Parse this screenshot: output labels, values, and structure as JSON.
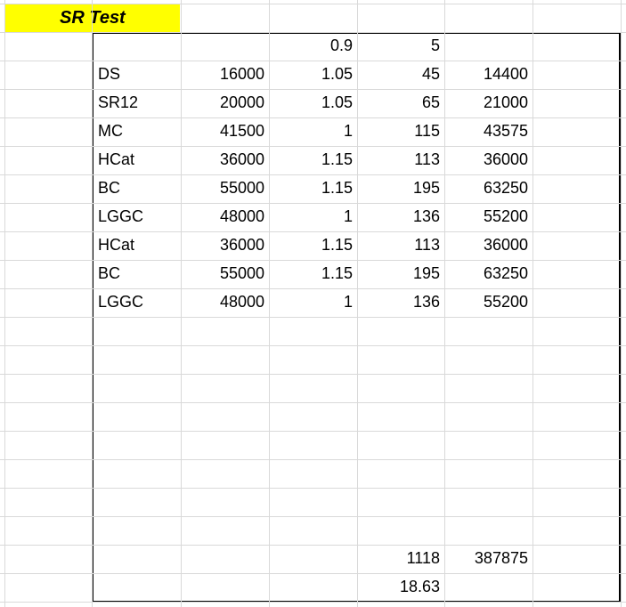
{
  "sheet": {
    "title": "SR Test",
    "header_row": [
      "",
      "",
      "0.9",
      "5",
      ""
    ],
    "rows": [
      [
        "DS",
        "16000",
        "1.05",
        "45",
        "14400"
      ],
      [
        "SR12",
        "20000",
        "1.05",
        "65",
        "21000"
      ],
      [
        "MC",
        "41500",
        "1",
        "115",
        "43575"
      ],
      [
        "HCat",
        "36000",
        "1.15",
        "113",
        "36000"
      ],
      [
        "BC",
        "55000",
        "1.15",
        "195",
        "63250"
      ],
      [
        "LGGC",
        "48000",
        "1",
        "136",
        "55200"
      ],
      [
        "HCat",
        "36000",
        "1.15",
        "113",
        "36000"
      ],
      [
        "BC",
        "55000",
        "1.15",
        "195",
        "63250"
      ],
      [
        "LGGC",
        "48000",
        "1",
        "136",
        "55200"
      ]
    ],
    "totals_row": [
      "",
      "",
      "",
      "1118",
      "387875"
    ],
    "ratio_row": [
      "",
      "",
      "",
      "18.63",
      ""
    ],
    "colors": {
      "title_bg": "#ffff00",
      "grid": "#d9d9d9",
      "border": "#000000"
    }
  }
}
